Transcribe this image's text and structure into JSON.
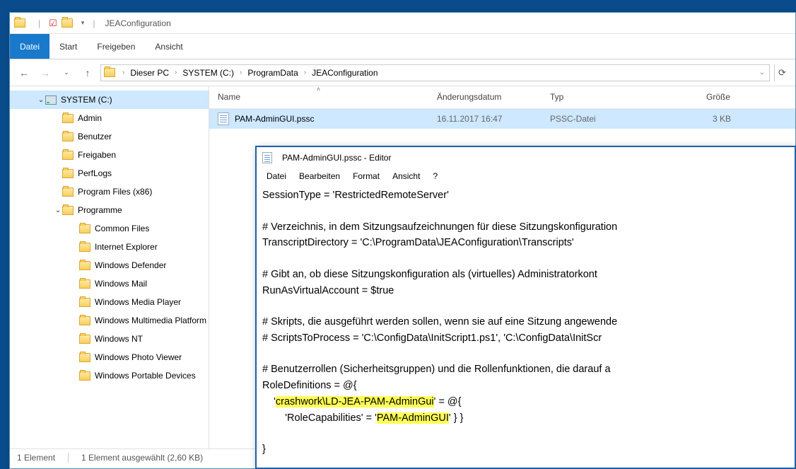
{
  "explorer": {
    "title": "JEAConfiguration",
    "ribbon": {
      "file": "Datei",
      "tabs": [
        "Start",
        "Freigeben",
        "Ansicht"
      ]
    },
    "breadcrumb": [
      "Dieser PC",
      "SYSTEM (C:)",
      "ProgramData",
      "JEAConfiguration"
    ],
    "nav_tree": {
      "drive": "SYSTEM (C:)",
      "level1": [
        "Admin",
        "Benutzer",
        "Freigaben",
        "PerfLogs",
        "Program Files (x86)"
      ],
      "programme": "Programme",
      "level2": [
        "Common Files",
        "Internet Explorer",
        "Windows Defender",
        "Windows Mail",
        "Windows Media Player",
        "Windows Multimedia Platform",
        "Windows NT",
        "Windows Photo Viewer",
        "Windows Portable Devices"
      ]
    },
    "columns": {
      "name": "Name",
      "date": "Änderungsdatum",
      "type": "Typ",
      "size": "Größe"
    },
    "files": [
      {
        "name": "PAM-AdminGUI.pssc",
        "date": "16.11.2017 16:47",
        "type": "PSSC-Datei",
        "size": "3 KB"
      }
    ],
    "status": {
      "count": "1 Element",
      "selected": "1 Element ausgewählt (2,60 KB)"
    }
  },
  "notepad": {
    "title": "PAM-AdminGUI.pssc - Editor",
    "menu": [
      "Datei",
      "Bearbeiten",
      "Format",
      "Ansicht",
      "?"
    ],
    "content": {
      "l1": "SessionType = 'RestrictedRemoteServer'",
      "l3": "# Verzeichnis, in dem Sitzungsaufzeichnungen für diese Sitzungskonfiguration",
      "l4": "TranscriptDirectory = 'C:\\ProgramData\\JEAConfiguration\\Transcripts'",
      "l6": "# Gibt an, ob diese Sitzungskonfiguration als (virtuelles) Administratorkont",
      "l7": "RunAsVirtualAccount = $true",
      "l9": "# Skripts, die ausgeführt werden sollen, wenn sie auf eine Sitzung angewende",
      "l10": "# ScriptsToProcess = 'C:\\ConfigData\\InitScript1.ps1', 'C:\\ConfigData\\InitScr",
      "l12": "# Benutzerrollen (Sicherheitsgruppen) und die Rollenfunktionen, die darauf a",
      "l13": "RoleDefinitions = @{",
      "l14a": "    '",
      "l14h": "crashwork\\LD-JEA-PAM-AdminGui",
      "l14b": "' = @{",
      "l15a": "        'RoleCapabilities' = '",
      "l15h": "PAM-AdminGUI",
      "l15b": "' } }",
      "l17": "}"
    }
  }
}
